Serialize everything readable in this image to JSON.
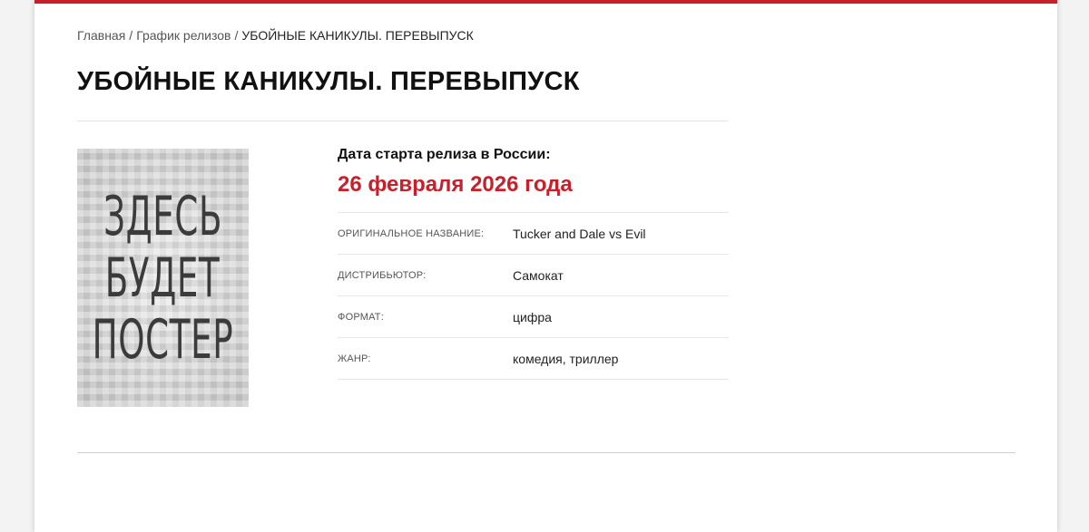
{
  "breadcrumb": {
    "home": "Главная",
    "schedule": "График релизов",
    "current": "УБОЙНЫЕ КАНИКУЛЫ. ПЕРЕВЫПУСК",
    "separator": "/"
  },
  "title": "УБОЙНЫЕ КАНИКУЛЫ. ПЕРЕВЫПУСК",
  "poster": {
    "lines": [
      "ЗДЕСЬ",
      "БУДЕТ",
      "ПОСТЕР"
    ]
  },
  "release": {
    "label": "Дата старта релиза в России:",
    "date": "26 февраля 2026 года"
  },
  "details": [
    {
      "label": "ОРИГИНАЛЬНОЕ НАЗВАНИЕ:",
      "value": "Tucker and Dale vs Evil"
    },
    {
      "label": "ДИСТРИБЬЮТОР:",
      "value": "Самокат"
    },
    {
      "label": "ФОРМАТ:",
      "value": "цифра"
    },
    {
      "label": "ЖАНР:",
      "value": "комедия, триллер"
    }
  ],
  "colors": {
    "accent": "#c8202a",
    "text": "#111111",
    "muted": "#555555"
  }
}
